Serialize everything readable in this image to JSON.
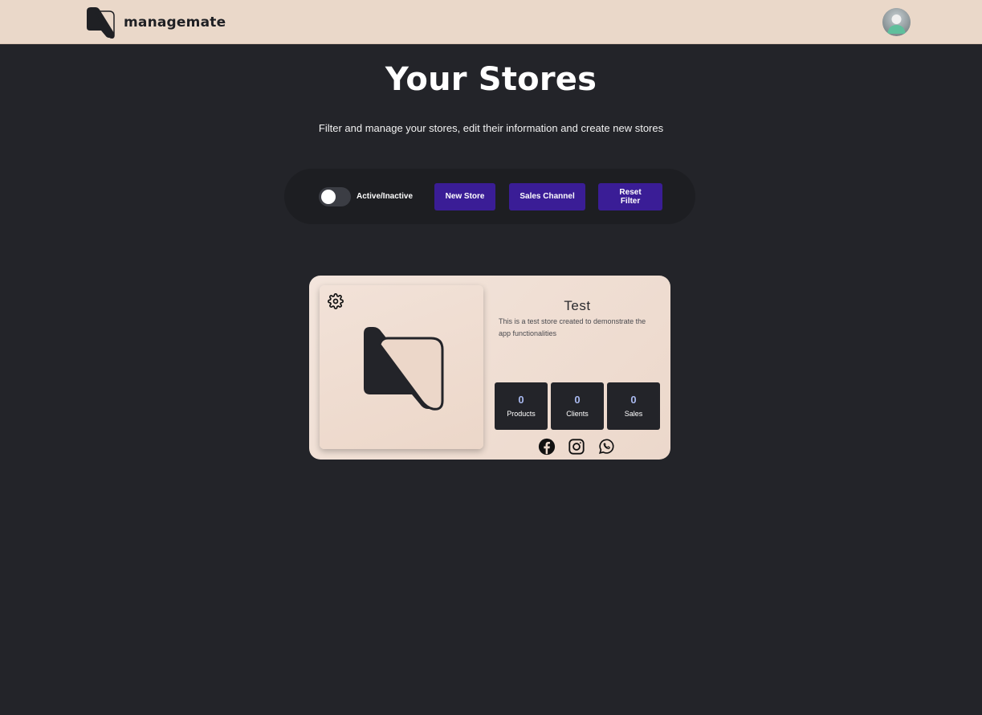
{
  "app": {
    "brand_name": "managemate",
    "colors": {
      "navbar_bg": "#ead8c9",
      "page_bg": "#232429",
      "accent_button": "#3a1d96",
      "stat_value": "#a9b9ef"
    }
  },
  "header": {
    "logo_icon": "managemate-logo-icon",
    "avatar_icon": "user-avatar-icon"
  },
  "main": {
    "title": "Your Stores",
    "subtitle": "Filter and manage your stores, edit their information and create new stores"
  },
  "toolbar": {
    "toggle_label": "Active/Inactive",
    "toggle_on": false,
    "new_store_label": "New Store",
    "sales_channel_label": "Sales Channel",
    "reset_filter_label": "Reset Filter"
  },
  "stores": [
    {
      "name": "Test",
      "description": "This is a test store created to demonstrate the app functionalities",
      "stats": [
        {
          "value": "0",
          "label": "Products"
        },
        {
          "value": "0",
          "label": "Clients"
        },
        {
          "value": "0",
          "label": "Sales"
        }
      ],
      "social_icons": [
        "facebook-icon",
        "instagram-icon",
        "whatsapp-icon"
      ]
    }
  ]
}
